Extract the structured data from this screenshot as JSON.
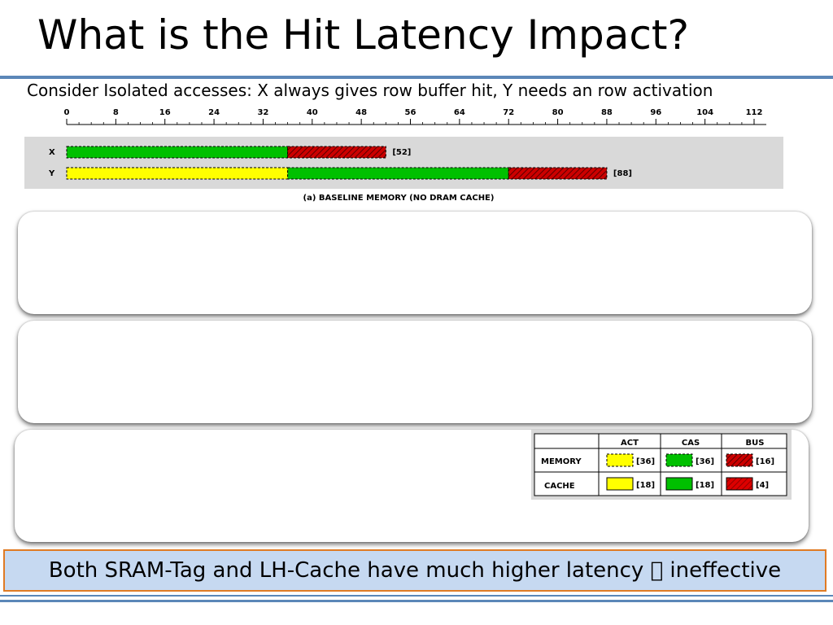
{
  "slide": {
    "title": "What is the Hit Latency Impact?",
    "subtitle": "Consider Isolated accesses: X always gives row buffer hit, Y needs an row activation",
    "conclusion": "Both SRAM-Tag and LH-Cache have much higher latency  ineffective"
  },
  "chart_data": {
    "type": "bar",
    "caption": "(a) BASELINE MEMORY (NO DRAM CACHE)",
    "x_ticks": [
      "0",
      "8",
      "16",
      "24",
      "32",
      "40",
      "48",
      "56",
      "64",
      "72",
      "80",
      "88",
      "96",
      "104",
      "112"
    ],
    "xlim": [
      0,
      112
    ],
    "rows": [
      {
        "label": "X",
        "total_label": "[52]",
        "segments": [
          {
            "component": "CAS",
            "start": 0,
            "end": 36
          },
          {
            "component": "BUS",
            "start": 36,
            "end": 52
          }
        ]
      },
      {
        "label": "Y",
        "total_label": "[88]",
        "segments": [
          {
            "component": "ACT",
            "start": 0,
            "end": 36
          },
          {
            "component": "CAS",
            "start": 36,
            "end": 72
          },
          {
            "component": "BUS",
            "start": 72,
            "end": 88
          }
        ]
      }
    ],
    "colors": {
      "ACT": "#ffff00",
      "CAS": "#00c000",
      "BUS": "#cc0000"
    }
  },
  "legend": {
    "headers": [
      "ACT",
      "CAS",
      "BUS"
    ],
    "rows": [
      {
        "label": "MEMORY",
        "values": [
          "[36]",
          "[36]",
          "[16]"
        ]
      },
      {
        "label": "CACHE",
        "values": [
          "[18]",
          "[18]",
          "[4]"
        ]
      }
    ]
  }
}
